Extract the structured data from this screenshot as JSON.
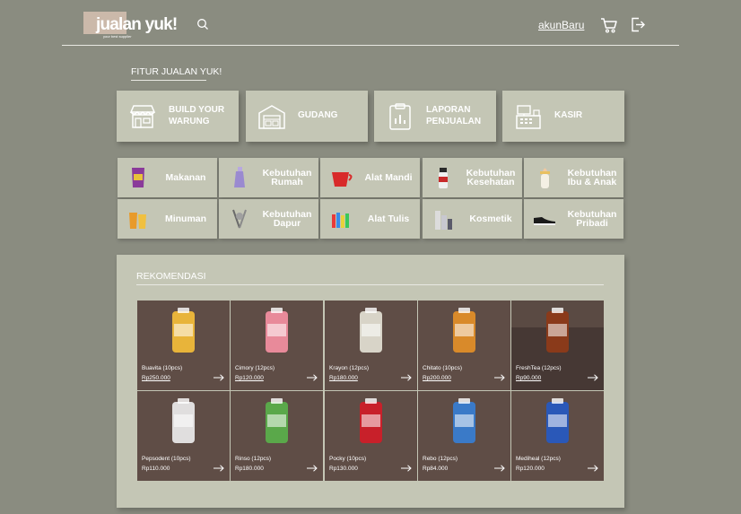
{
  "header": {
    "logo": "jualan yuk!",
    "tagline": "your best supplier",
    "account_label": "akunBaru",
    "icons": [
      "search-icon",
      "cart-icon",
      "logout-icon"
    ]
  },
  "features": {
    "title": "FITUR JUALAN YUK!",
    "items": [
      {
        "label": "BUILD YOUR WARUNG",
        "icon": "shop-icon"
      },
      {
        "label": "GUDANG",
        "icon": "warehouse-icon"
      },
      {
        "label": "LAPORAN PENJUALAN",
        "icon": "report-icon"
      },
      {
        "label": "KASIR",
        "icon": "cashier-icon"
      }
    ]
  },
  "categories": [
    {
      "label": "Makanan",
      "icon": "snack-icon"
    },
    {
      "label": "Kebutuhan Rumah",
      "icon": "household-icon"
    },
    {
      "label": "Alat Mandi",
      "icon": "bath-icon"
    },
    {
      "label": "Kebutuhan Kesehatan",
      "icon": "health-icon"
    },
    {
      "label": "Kebutuhan Ibu & Anak",
      "icon": "baby-bottle-icon"
    },
    {
      "label": "Minuman",
      "icon": "drink-icon"
    },
    {
      "label": "Kebutuhan Dapur",
      "icon": "kitchen-icon"
    },
    {
      "label": "Alat Tulis",
      "icon": "stationery-icon"
    },
    {
      "label": "Kosmetik",
      "icon": "cosmetic-icon"
    },
    {
      "label": "Kebutuhan Pribadi",
      "icon": "shoe-icon"
    }
  ],
  "recommendation": {
    "title": "REKOMENDASI",
    "products": [
      {
        "name": "Buavita (10pcs)",
        "price": "Rp250.000",
        "color": "#e8b43a"
      },
      {
        "name": "Cimory (12pcs)",
        "price": "Rp120.000",
        "color": "#e88a9a"
      },
      {
        "name": "Krayon (12pcs)",
        "price": "Rp180.000",
        "color": "#d8d4c8"
      },
      {
        "name": "Chitato (10pcs)",
        "price": "Rp200.000",
        "color": "#d98a2a"
      },
      {
        "name": "FreshTea (12pcs)",
        "price": "Rp90.000",
        "color": "#8a3a1a"
      },
      {
        "name": "Pepsodent (10pcs)",
        "price": "Rp110.000",
        "color": "#e0dede"
      },
      {
        "name": "Rinso (12pcs)",
        "price": "Rp180.000",
        "color": "#5aa84a"
      },
      {
        "name": "Pocky (10pcs)",
        "price": "Rp130.000",
        "color": "#c8202a"
      },
      {
        "name": "Rebo (12pcs)",
        "price": "Rp84.000",
        "color": "#3a7ac8"
      },
      {
        "name": "Mediheal (12pcs)",
        "price": "Rp120.000",
        "color": "#2a58b8"
      }
    ]
  }
}
